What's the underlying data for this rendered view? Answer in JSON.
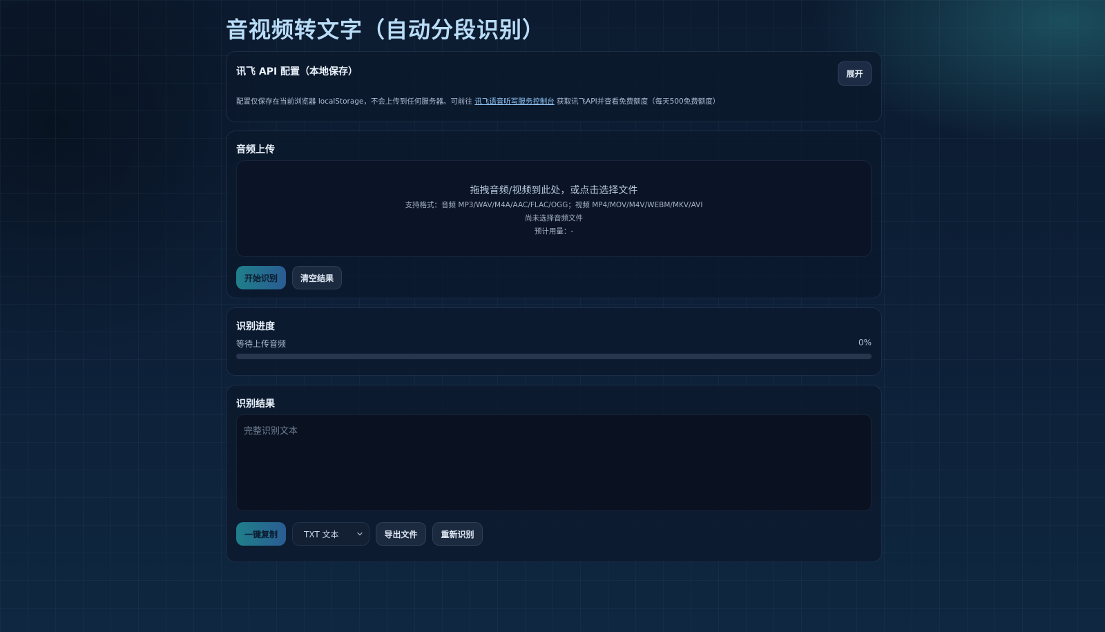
{
  "page": {
    "title": "音视频转文字（自动分段识别）"
  },
  "api_config": {
    "title": "讯飞 API 配置（本地保存）",
    "expand_label": "展开",
    "note_prefix": "配置仅保存在当前浏览器 localStorage，不会上传到任何服务器。可前往 ",
    "note_link": "讯飞语音听写服务控制台",
    "note_suffix": " 获取讯飞API并查看免费额度（每天500免费额度）"
  },
  "upload": {
    "title": "音频上传",
    "drop_main": "拖拽音频/视频到此处，或点击选择文件",
    "formats": "支持格式：音频 MP3/WAV/M4A/AAC/FLAC/OGG；视频 MP4/MOV/M4V/WEBM/MKV/AVI",
    "file_status": "尚未选择音频文件",
    "usage": "预计用量：-",
    "start_label": "开始识别",
    "clear_label": "清空结果"
  },
  "progress": {
    "title": "识别进度",
    "status": "等待上传音频",
    "percent_label": "0%",
    "value": 0
  },
  "result": {
    "title": "识别结果",
    "placeholder": "完整识别文本",
    "value": "",
    "copy_label": "一键复制",
    "format_selected": "TXT 文本",
    "export_label": "导出文件",
    "retry_label": "重新识别"
  },
  "colors": {
    "accent_start": "#1f7f8a",
    "accent_end": "#2a5c93",
    "title": "#b9dcf7",
    "link": "#8fc3f2",
    "progress_fill": "#3aa6c0"
  },
  "icons": {
    "format_dropdown": "chevron-down-icon"
  }
}
